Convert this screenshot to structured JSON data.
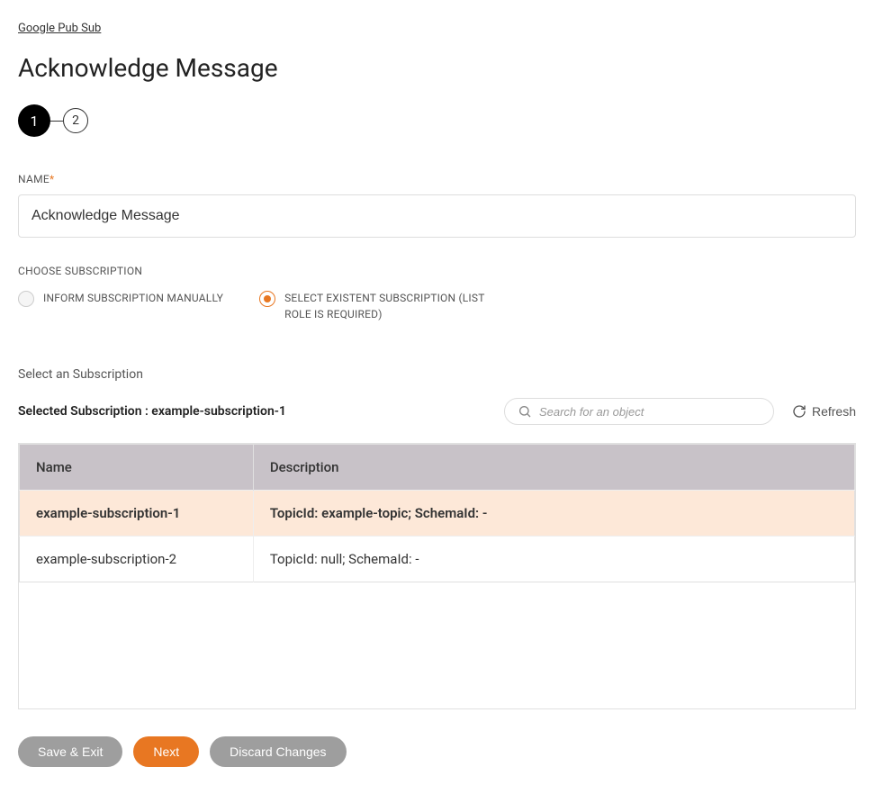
{
  "breadcrumb": "Google Pub Sub",
  "page_title": "Acknowledge Message",
  "stepper": {
    "step1": "1",
    "step2": "2"
  },
  "name_field": {
    "label": "NAME",
    "value": "Acknowledge Message"
  },
  "choose_subscription": {
    "label": "CHOOSE SUBSCRIPTION",
    "options": {
      "manual": "INFORM SUBSCRIPTION MANUALLY",
      "existent": "SELECT EXISTENT SUBSCRIPTION (LIST ROLE IS REQUIRED)"
    }
  },
  "select_section": {
    "label": "Select an Subscription",
    "selected_text": "Selected Subscription : example-subscription-1",
    "search_placeholder": "Search for an object",
    "refresh_label": "Refresh"
  },
  "table": {
    "headers": {
      "name": "Name",
      "description": "Description"
    },
    "rows": [
      {
        "name": "example-subscription-1",
        "description": "TopicId: example-topic; SchemaId: -",
        "selected": true
      },
      {
        "name": "example-subscription-2",
        "description": "TopicId: null; SchemaId: -",
        "selected": false
      }
    ]
  },
  "buttons": {
    "save_exit": "Save & Exit",
    "next": "Next",
    "discard": "Discard Changes"
  }
}
